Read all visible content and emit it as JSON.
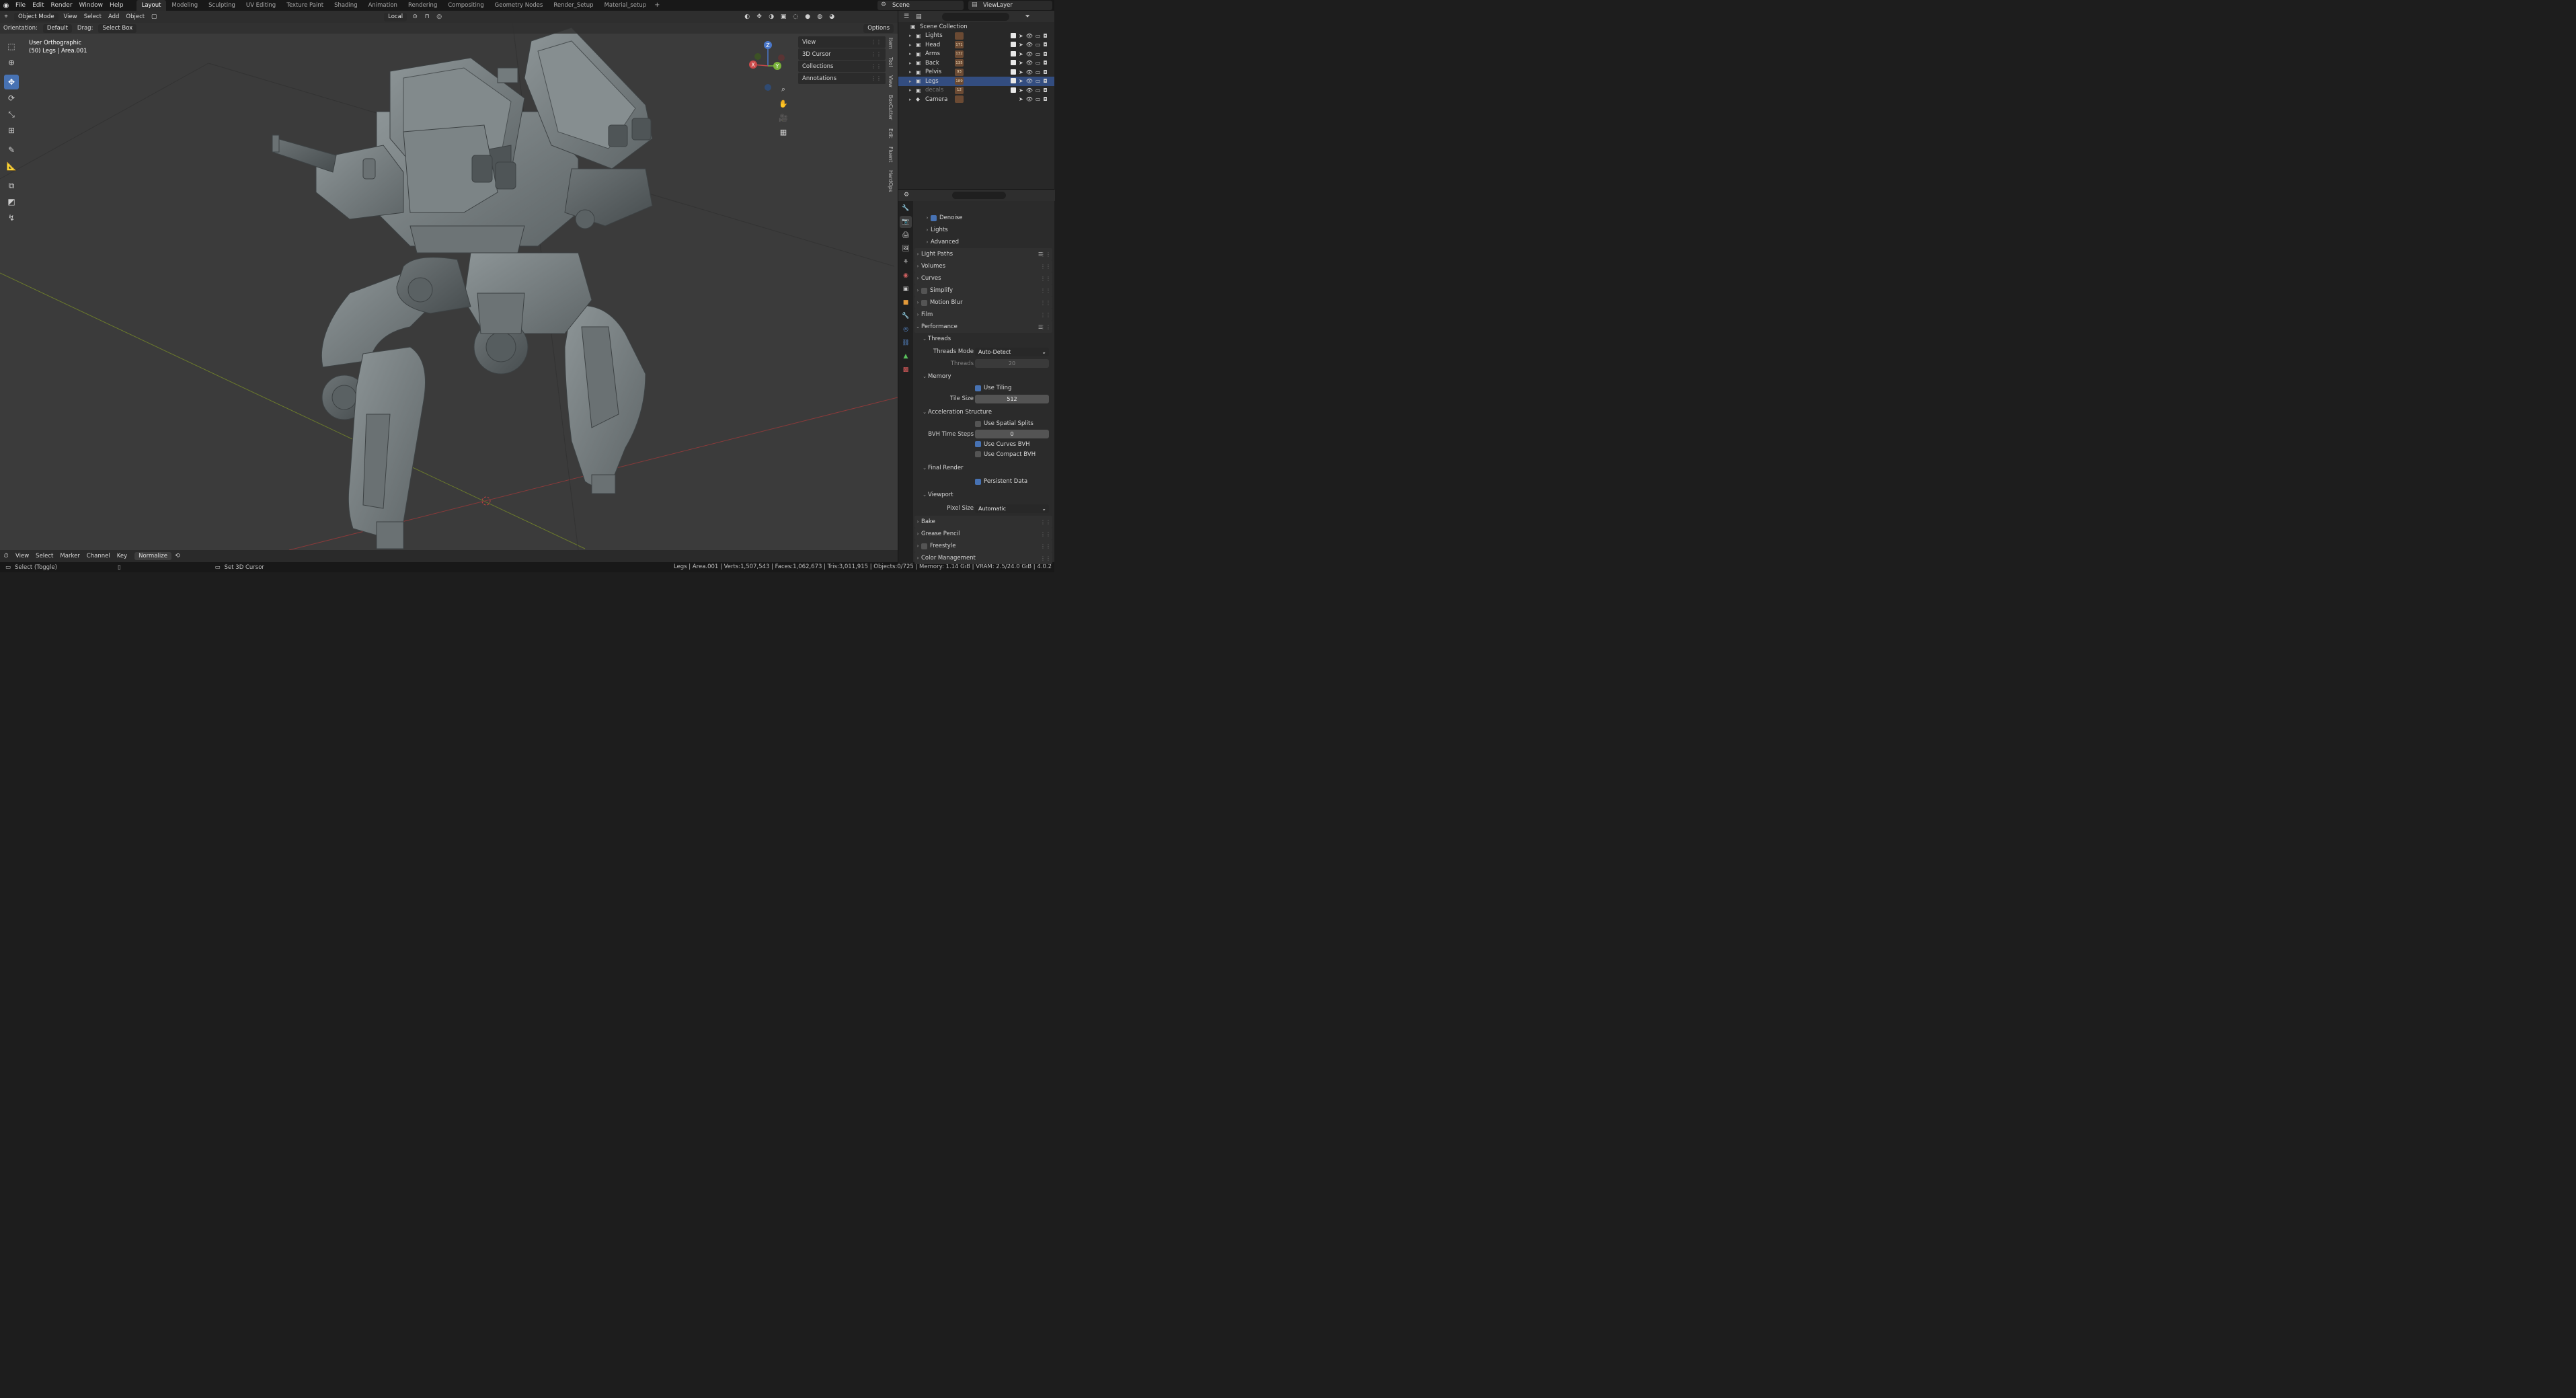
{
  "topbar": {
    "menu": [
      "File",
      "Edit",
      "Render",
      "Window",
      "Help"
    ],
    "workspaces": [
      "Layout",
      "Modeling",
      "Sculpting",
      "UV Editing",
      "Texture Paint",
      "Shading",
      "Animation",
      "Rendering",
      "Compositing",
      "Geometry Nodes",
      "Render_Setup",
      "Material_setup"
    ],
    "active_workspace": "Layout",
    "plus": "+",
    "scene": "Scene",
    "view_layer": "ViewLayer"
  },
  "viewport_header": {
    "mode": "Object Mode",
    "menus": [
      "View",
      "Select",
      "Add",
      "Object"
    ],
    "transform_orientation": "Local",
    "options": "Options"
  },
  "viewport_header2": {
    "orientation_label": "Orientation:",
    "orientation_value": "Default",
    "drag_label": "Drag:",
    "drag_value": "Select Box"
  },
  "viewport_info": {
    "view_name": "User Orthographic",
    "object_info": "(50) Legs | Area.001"
  },
  "npanel": {
    "items": [
      "View",
      "3D Cursor",
      "Collections",
      "Annotations"
    ],
    "side_tabs": [
      "Item",
      "Tool",
      "View",
      "BoxCutter",
      "Edit",
      "Fluent",
      "HardOps"
    ]
  },
  "gizmo": {
    "x": "X",
    "y": "Y",
    "z": "Z"
  },
  "outliner": {
    "root": "Scene Collection",
    "rows": [
      {
        "name": "Lights",
        "badge": "",
        "selected": false,
        "dim": false
      },
      {
        "name": "Head",
        "badge": "171",
        "selected": false,
        "dim": false
      },
      {
        "name": "Arms",
        "badge": "132",
        "selected": false,
        "dim": false
      },
      {
        "name": "Back",
        "badge": "135",
        "selected": false,
        "dim": false
      },
      {
        "name": "Pelvis",
        "badge": "93",
        "selected": false,
        "dim": false
      },
      {
        "name": "Legs",
        "badge": "189",
        "selected": true,
        "dim": false
      },
      {
        "name": "decals",
        "badge": "12",
        "selected": false,
        "dim": true
      },
      {
        "name": "Camera",
        "badge": "",
        "selected": false,
        "dim": false
      }
    ]
  },
  "properties": {
    "top_items": [
      {
        "label": "Denoise",
        "checkbox": true
      },
      {
        "label": "Lights",
        "checkbox": null
      },
      {
        "label": "Advanced",
        "checkbox": null
      }
    ],
    "panels": [
      {
        "label": "Light Paths"
      },
      {
        "label": "Volumes"
      },
      {
        "label": "Curves"
      },
      {
        "label": "Simplify"
      },
      {
        "label": "Motion Blur"
      },
      {
        "label": "Film"
      }
    ],
    "performance": {
      "label": "Performance",
      "threads": {
        "label": "Threads",
        "mode_label": "Threads Mode",
        "mode_value": "Auto-Detect",
        "threads_label": "Threads",
        "threads_value": "20"
      },
      "memory": {
        "label": "Memory",
        "use_tiling": "Use Tiling",
        "tile_size_label": "Tile Size",
        "tile_size_value": "512"
      },
      "accel": {
        "label": "Acceleration Structure",
        "spatial": "Use Spatial Splits",
        "bvh_label": "BVH Time Steps",
        "bvh_value": "0",
        "curves_bvh": "Use Curves BVH",
        "compact_bvh": "Use Compact BVH"
      },
      "final_render": {
        "label": "Final Render",
        "persistent": "Persistent Data"
      },
      "viewport": {
        "label": "Viewport",
        "pixel_size_label": "Pixel Size",
        "pixel_size_value": "Automatic"
      }
    },
    "bottom_panels": [
      "Bake",
      "Grease Pencil",
      "Freestyle",
      "Color Management"
    ]
  },
  "timeline": {
    "menus": [
      "View",
      "Select",
      "Marker",
      "Channel",
      "Key"
    ],
    "normalize": "Normalize"
  },
  "statusbar": {
    "left": "Select (Toggle)",
    "middle": "Set 3D Cursor",
    "right": "Legs | Area.001 | Verts:1,507,543 | Faces:1,062,673 | Tris:3,011,915 | Objects:0/725 | Memory: 1.14 GiB | VRAM: 2.5/24.0 GiB | 4.0.2"
  },
  "colors": {
    "accent": "#4772b3",
    "selection": "#334d80",
    "viewport_bg": "#3b3b3b",
    "model": "#7d8587"
  }
}
